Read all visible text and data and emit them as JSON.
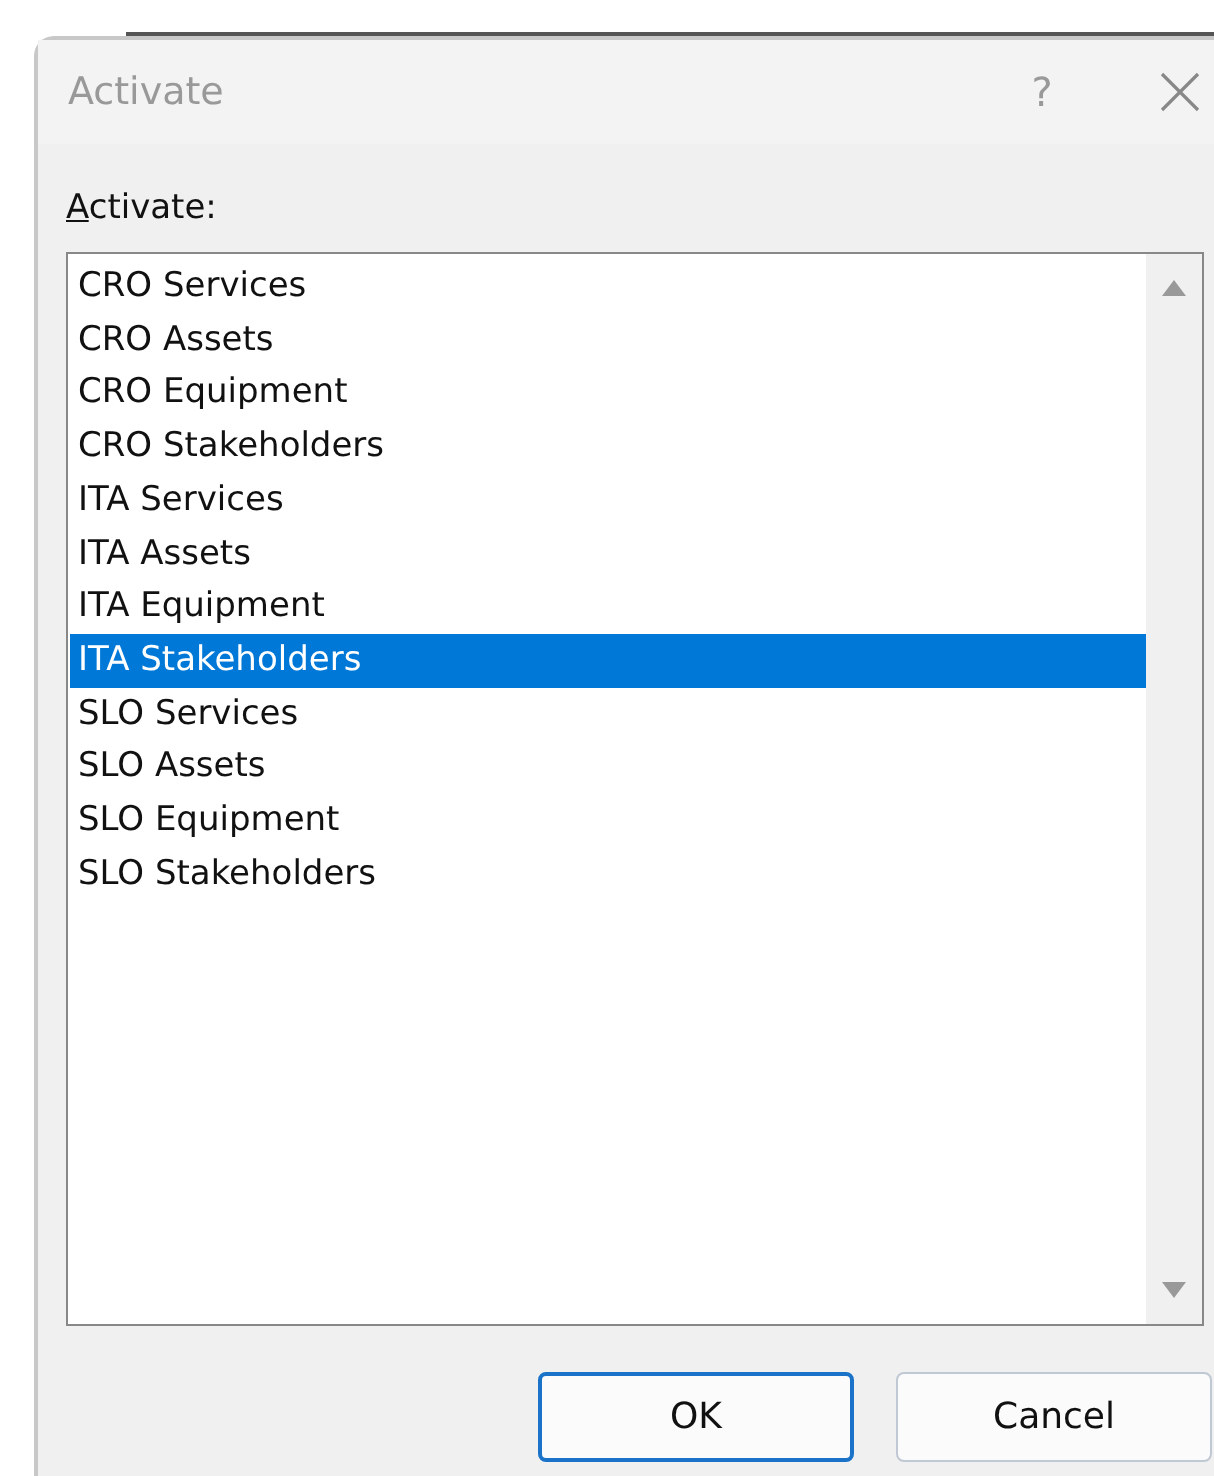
{
  "dialog": {
    "title": "Activate",
    "help_glyph": "?"
  },
  "label": {
    "text": "Activate:",
    "access_key_underlined": true
  },
  "list": {
    "items": [
      {
        "text": "CRO Services",
        "selected": false
      },
      {
        "text": "CRO Assets",
        "selected": false
      },
      {
        "text": "CRO Equipment",
        "selected": false
      },
      {
        "text": "CRO Stakeholders",
        "selected": false
      },
      {
        "text": "ITA Services",
        "selected": false
      },
      {
        "text": "ITA Assets",
        "selected": false
      },
      {
        "text": "ITA Equipment",
        "selected": false
      },
      {
        "text": "ITA Stakeholders",
        "selected": true
      },
      {
        "text": "SLO Services",
        "selected": false
      },
      {
        "text": "SLO Assets",
        "selected": false
      },
      {
        "text": "SLO Equipment",
        "selected": false
      },
      {
        "text": "SLO Stakeholders",
        "selected": false
      }
    ]
  },
  "buttons": [
    {
      "label": "OK",
      "default": true
    },
    {
      "label": "Cancel",
      "default": false
    }
  ]
}
